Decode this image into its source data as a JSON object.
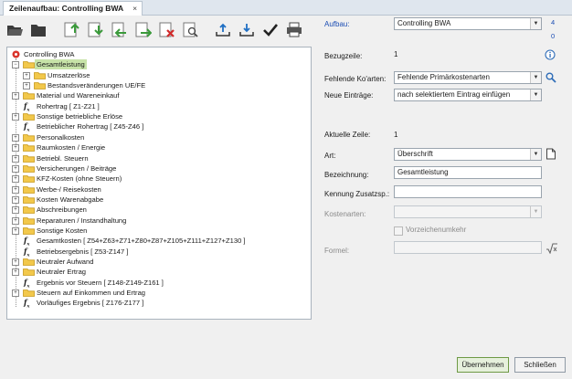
{
  "tab": {
    "title": "Zeilenaufbau: Controlling BWA",
    "close": "×"
  },
  "toolbar": {
    "icons": [
      "folder-open-icon",
      "folder-icon",
      "insert-above-icon",
      "insert-below-icon",
      "move-left-icon",
      "move-right-icon",
      "delete-row-icon",
      "search-doc-icon",
      "export-up-icon",
      "import-down-icon",
      "confirm-check-icon",
      "print-icon"
    ]
  },
  "header": {
    "aufbau_label": "Aufbau:",
    "aufbau_value": "Controlling BWA",
    "count_top": "4",
    "count_bottom": "0"
  },
  "tree": {
    "root": "Controlling BWA",
    "items": [
      {
        "text": "Gesamtleistung",
        "level": 1,
        "kind": "folder",
        "selected": true,
        "expander": "-"
      },
      {
        "text": "Umsatzerlöse",
        "level": 2,
        "kind": "folder",
        "expander": "+"
      },
      {
        "text": "Bestandsveränderungen UE/FE",
        "level": 2,
        "kind": "folder",
        "expander": "+"
      },
      {
        "text": "Material und Wareneinkauf",
        "level": 1,
        "kind": "folder",
        "expander": "+"
      },
      {
        "text": "Rohertrag [ Z1-Z21 ]",
        "level": 1,
        "kind": "formula"
      },
      {
        "text": "Sonstige betriebliche Erlöse",
        "level": 1,
        "kind": "folder",
        "expander": "+"
      },
      {
        "text": "Betrieblicher Rohertrag [ Z45-Z46 ]",
        "level": 1,
        "kind": "formula"
      },
      {
        "text": "Personalkosten",
        "level": 1,
        "kind": "folder",
        "expander": "+"
      },
      {
        "text": "Raumkosten / Energie",
        "level": 1,
        "kind": "folder",
        "expander": "+"
      },
      {
        "text": "Betriebl. Steuern",
        "level": 1,
        "kind": "folder",
        "expander": "+"
      },
      {
        "text": "Versicherungen / Beiträge",
        "level": 1,
        "kind": "folder",
        "expander": "+"
      },
      {
        "text": "KFZ-Kosten (ohne Steuern)",
        "level": 1,
        "kind": "folder",
        "expander": "+"
      },
      {
        "text": "Werbe-/ Reisekosten",
        "level": 1,
        "kind": "folder",
        "expander": "+"
      },
      {
        "text": "Kosten Warenabgabe",
        "level": 1,
        "kind": "folder",
        "expander": "+"
      },
      {
        "text": "Abschreibungen",
        "level": 1,
        "kind": "folder",
        "expander": "+"
      },
      {
        "text": "Reparaturen / Instandhaltung",
        "level": 1,
        "kind": "folder",
        "expander": "+"
      },
      {
        "text": "Sonstige Kosten",
        "level": 1,
        "kind": "folder",
        "expander": "+"
      },
      {
        "text": "Gesamtkosten [ Z54+Z63+Z71+Z80+Z87+Z105+Z111+Z127+Z130 ]",
        "level": 1,
        "kind": "formula"
      },
      {
        "text": "Betriebsergebnis [ Z53-Z147 ]",
        "level": 1,
        "kind": "formula"
      },
      {
        "text": "Neutraler Aufwand",
        "level": 1,
        "kind": "folder",
        "expander": "+"
      },
      {
        "text": "Neutraler Ertrag",
        "level": 1,
        "kind": "folder",
        "expander": "+"
      },
      {
        "text": "Ergebnis vor Steuern [ Z148-Z149-Z161 ]",
        "level": 1,
        "kind": "formula"
      },
      {
        "text": "Steuern auf Einkommen und Ertrag",
        "level": 1,
        "kind": "folder",
        "expander": "+"
      },
      {
        "text": "Vorläufiges Ergebnis [ Z176-Z177 ]",
        "level": 1,
        "kind": "formula"
      }
    ]
  },
  "form": {
    "bezugzeile_label": "Bezugzeile:",
    "bezugzeile_value": "1",
    "fehlende_label": "Fehlende Ko'arten:",
    "fehlende_value": "Fehlende Primärkostenarten",
    "neue_label": "Neue Einträge:",
    "neue_value": "nach selektiertem Eintrag einfügen",
    "aktuelle_label": "Aktuelle Zeile:",
    "aktuelle_value": "1",
    "art_label": "Art:",
    "art_value": "Überschrift",
    "bezeichnung_label": "Bezeichnung:",
    "bezeichnung_value": "Gesamtleistung",
    "kennung_label": "Kennung Zusatzsp.:",
    "kennung_value": "",
    "kostenarten_label": "Kostenarten:",
    "kostenarten_value": "",
    "vorzeichen_label": "Vorzeichenumkehr",
    "formel_label": "Formel:",
    "formel_value": ""
  },
  "buttons": {
    "ok": "Übernehmen",
    "close": "Schließen"
  },
  "colors": {
    "selection": "#c7e3a8",
    "folder": "#f2c84b",
    "accent_blue": "#1b4db3"
  }
}
